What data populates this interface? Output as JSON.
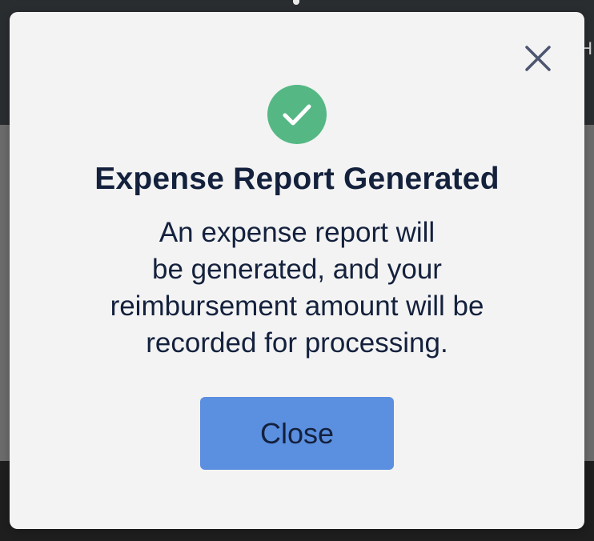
{
  "dialog": {
    "title": "Expense Report Generated",
    "message_lines": [
      "An expense report will",
      "be generated, and your",
      "reimbursement amount will be",
      "recorded for processing."
    ],
    "close_button_label": "Close",
    "close_icon": "close-icon",
    "status_icon": "checkmark-icon"
  },
  "colors": {
    "success": "#55b884",
    "button": "#5b8fdf",
    "text": "#14213d",
    "dialog_background": "#f3f3f3"
  }
}
